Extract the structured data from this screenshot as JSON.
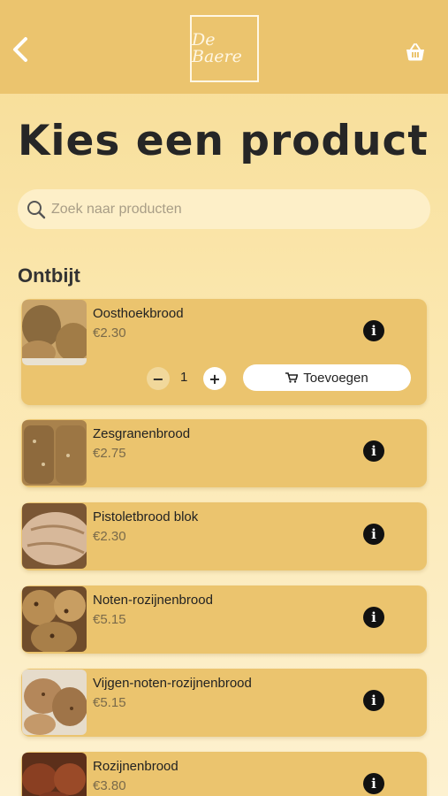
{
  "header": {
    "back_icon": "chevron-left-icon",
    "logo_text": "De Baere",
    "basket_icon": "basket-icon"
  },
  "page": {
    "title": "Kies een product"
  },
  "search": {
    "placeholder": "Zoek naar producten",
    "value": ""
  },
  "section": {
    "title": "Ontbijt"
  },
  "products": [
    {
      "name": "Oosthoekbrood",
      "price": "€2.30",
      "expanded": true,
      "quantity": "1",
      "add_label": "Toevoegen"
    },
    {
      "name": "Zesgranenbrood",
      "price": "€2.75"
    },
    {
      "name": "Pistoletbrood blok",
      "price": "€2.30"
    },
    {
      "name": "Noten-rozijnenbrood",
      "price": "€5.15"
    },
    {
      "name": "Vijgen-noten-rozijnenbrood",
      "price": "€5.15"
    },
    {
      "name": "Rozijnenbrood",
      "price": "€3.80"
    }
  ],
  "colors": {
    "header": "#ebc46e",
    "card": "#ebc46e",
    "background": "#fbe7ae",
    "info_button": "#111111"
  }
}
